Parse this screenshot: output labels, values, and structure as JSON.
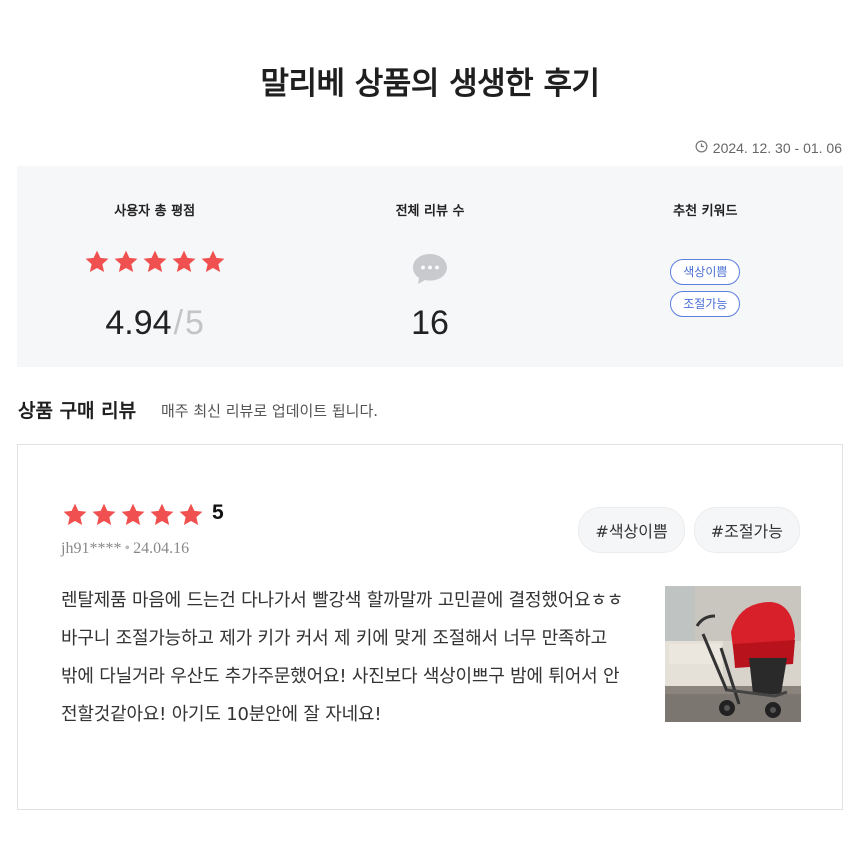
{
  "page": {
    "title": "말리베 상품의 생생한 후기",
    "date_range": "2024. 12. 30 - 01. 06"
  },
  "summary": {
    "rating_label": "사용자 총 평점",
    "rating": "4.94",
    "rating_slash": "/",
    "rating_max": "5",
    "stars": 5,
    "review_count_label": "전체 리뷰 수",
    "review_count": "16",
    "keywords_label": "추천 키워드",
    "keywords": [
      "색상이쁨",
      "조절가능"
    ]
  },
  "section": {
    "title": "상품 구매 리뷰",
    "subtitle": "매주 최신 리뷰로 업데이트 됩니다."
  },
  "review": {
    "stars": 5,
    "score": "5",
    "user": "jh91****",
    "separator": "•",
    "date": "24.04.16",
    "tags": [
      "#색상이쁨",
      "#조절가능"
    ],
    "body": "렌탈제품 마음에 드는건 다나가서 빨강색 할까말까 고민끝에 결정했어요ㅎㅎ 바구니 조절가능하고 제가 키가 커서 제 키에 맞게 조절해서 너무 만족하고 밖에 다닐거라 우산도 추가주문했어요! 사진보다 색상이쁘구 밤에 튀어서 안전할것같아요! 아기도 10분안에 잘 자네요!"
  },
  "colors": {
    "star": "#f0504f",
    "keyword_border": "#5b7fe0",
    "summary_bg": "#f6f7f9"
  },
  "icons": {
    "clock": "clock-icon",
    "star": "star-icon",
    "chat": "chat-bubble-icon"
  }
}
